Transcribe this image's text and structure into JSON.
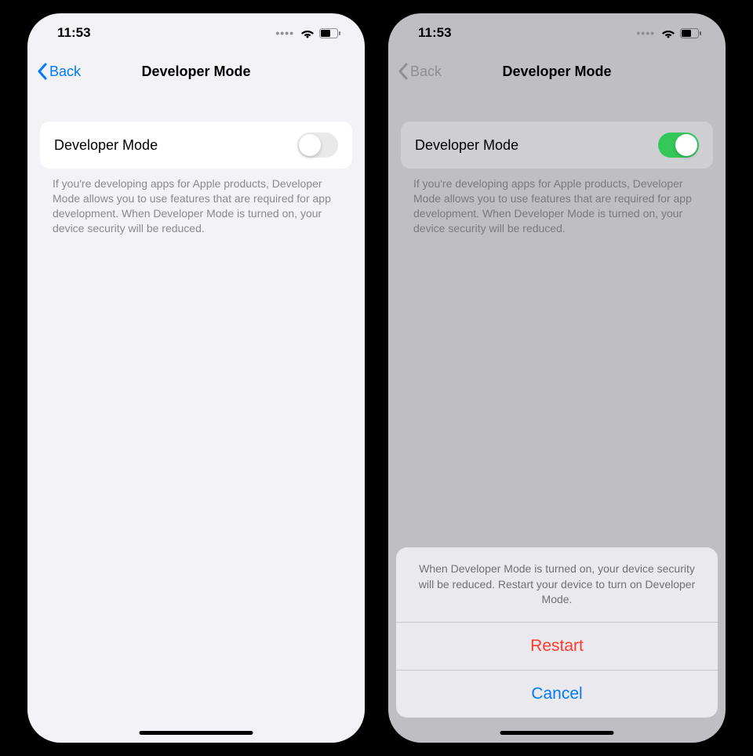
{
  "screens": {
    "left": {
      "status_bar": {
        "time": "11:53"
      },
      "nav": {
        "back_label": "Back",
        "title": "Developer Mode"
      },
      "setting": {
        "label": "Developer Mode",
        "toggle_on": false
      },
      "description": "If you're developing apps for Apple products, Developer Mode allows you to use features that are required for app development. When Developer Mode is turned on, your device security will be reduced."
    },
    "right": {
      "status_bar": {
        "time": "11:53"
      },
      "nav": {
        "back_label": "Back",
        "title": "Developer Mode"
      },
      "setting": {
        "label": "Developer Mode",
        "toggle_on": true
      },
      "description": "If you're developing apps for Apple products, Developer Mode allows you to use features that are required for app development. When Developer Mode is turned on, your device security will be reduced.",
      "action_sheet": {
        "message": "When Developer Mode is turned on, your device security will be reduced. Restart your device to turn on Developer Mode.",
        "restart_label": "Restart",
        "cancel_label": "Cancel"
      }
    }
  }
}
